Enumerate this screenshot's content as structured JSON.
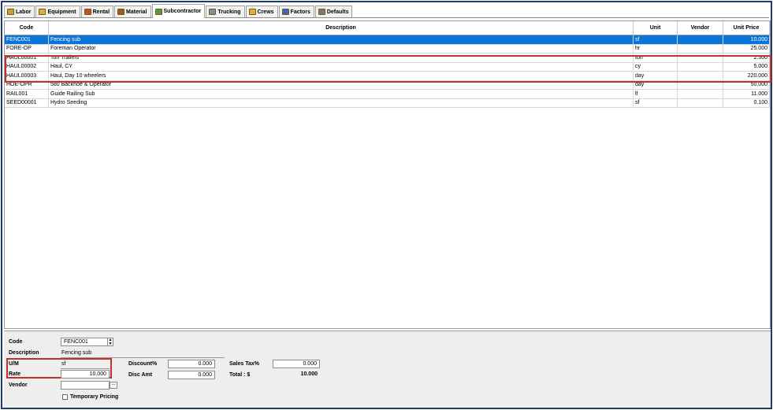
{
  "tabs": [
    {
      "label": "Labor",
      "icon": "labor-icon",
      "color": "#c8a030"
    },
    {
      "label": "Equipment",
      "icon": "equipment-icon",
      "color": "#d8b040"
    },
    {
      "label": "Rental",
      "icon": "rental-icon",
      "color": "#c05030"
    },
    {
      "label": "Material",
      "icon": "material-icon",
      "color": "#a05a20"
    },
    {
      "label": "Subcontractor",
      "icon": "subcontractor-icon",
      "color": "#4aa04a"
    },
    {
      "label": "Trucking",
      "icon": "trucking-icon",
      "color": "#8a8a8a"
    },
    {
      "label": "Crews",
      "icon": "crews-icon",
      "color": "#e0b030"
    },
    {
      "label": "Factors",
      "icon": "factors-icon",
      "color": "#3a6ac0"
    },
    {
      "label": "Defaults",
      "icon": "defaults-icon",
      "color": "#7a7a7a"
    }
  ],
  "active_tab": "Subcontractor",
  "grid": {
    "headers": {
      "code": "Code",
      "description": "Description",
      "unit": "Unit",
      "vendor": "Vendor",
      "unit_price": "Unit Price"
    },
    "rows": [
      {
        "code": "FENC001",
        "description": "Fencing sub",
        "unit": "sf",
        "vendor": "",
        "unit_price": "10.000"
      },
      {
        "code": "FORE-OP",
        "description": "Foreman Operator",
        "unit": "hr",
        "vendor": "",
        "unit_price": "25.000"
      },
      {
        "code": "HAUL00001",
        "description": "Ton Trailers",
        "unit": "ton",
        "vendor": "",
        "unit_price": "2.500"
      },
      {
        "code": "HAUL00002",
        "description": "Haul, CY",
        "unit": "cy",
        "vendor": "",
        "unit_price": "5.000"
      },
      {
        "code": "HAUL00003",
        "description": "Haul, Day 10 wheelers",
        "unit": "day",
        "vendor": "",
        "unit_price": "220.000"
      },
      {
        "code": "HOE-OPR",
        "description": "580 Backhoe & Operator",
        "unit": "day",
        "vendor": "",
        "unit_price": "50.000"
      },
      {
        "code": "RAIL001",
        "description": "Guide Railing Sub",
        "unit": "lf",
        "vendor": "",
        "unit_price": "11.000"
      },
      {
        "code": "SEED00001",
        "description": "Hydro Seeding",
        "unit": "sf",
        "vendor": "",
        "unit_price": "0.100"
      }
    ],
    "selected_index": 0
  },
  "form": {
    "code_label": "Code",
    "code_value": "FENC001",
    "description_label": "Description",
    "description_value": "Fencing sub",
    "um_label": "U/M",
    "um_value": "sf",
    "rate_label": "Rate",
    "rate_value": "10.000",
    "vendor_label": "Vendor",
    "vendor_value": "",
    "temporary_pricing_label": "Temporary Pricing",
    "discount_label": "Discount%",
    "discount_value": "0.000",
    "disc_amt_label": "Disc Amt",
    "disc_amt_value": "0.000",
    "sales_tax_label": "Sales Tax%",
    "sales_tax_value": "0.000",
    "total_label": "Total : $",
    "total_value": "10.000"
  },
  "colors": {
    "selection": "#0a74d9",
    "highlight": "#c0322a",
    "frame": "#1f3a6e"
  }
}
